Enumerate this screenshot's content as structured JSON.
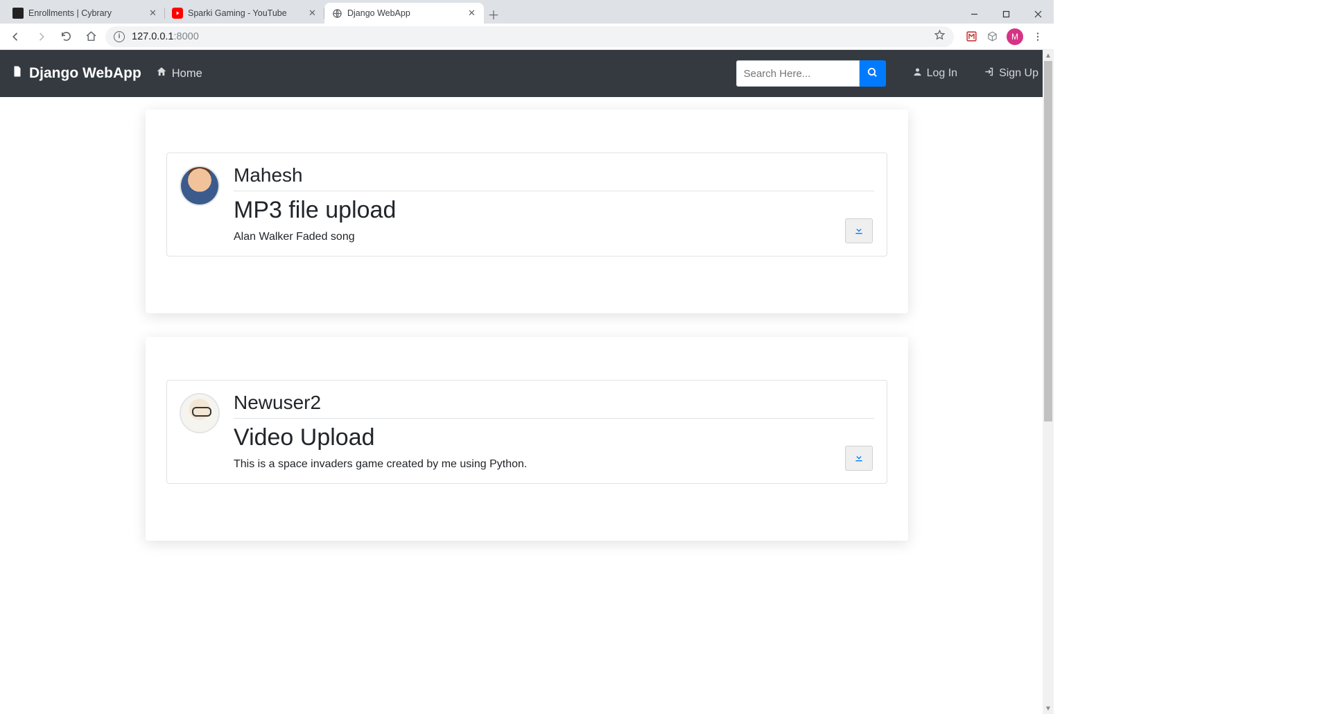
{
  "browser": {
    "tabs": [
      {
        "title": "Enrollments | Cybrary",
        "active": false
      },
      {
        "title": "Sparki Gaming - YouTube",
        "active": false
      },
      {
        "title": "Django WebApp",
        "active": true
      }
    ],
    "url_host": "127.0.0.1",
    "url_port": ":8000",
    "profile_initial": "M"
  },
  "nav": {
    "brand": "Django WebApp",
    "home": "Home",
    "search_placeholder": "Search Here...",
    "login": "Log In",
    "signup": "Sign Up"
  },
  "posts": [
    {
      "author": "Mahesh",
      "title": "MP3 file upload",
      "description": "Alan Walker Faded song"
    },
    {
      "author": "Newuser2",
      "title": "Video Upload",
      "description": "This is a space invaders game created by me using Python."
    }
  ]
}
